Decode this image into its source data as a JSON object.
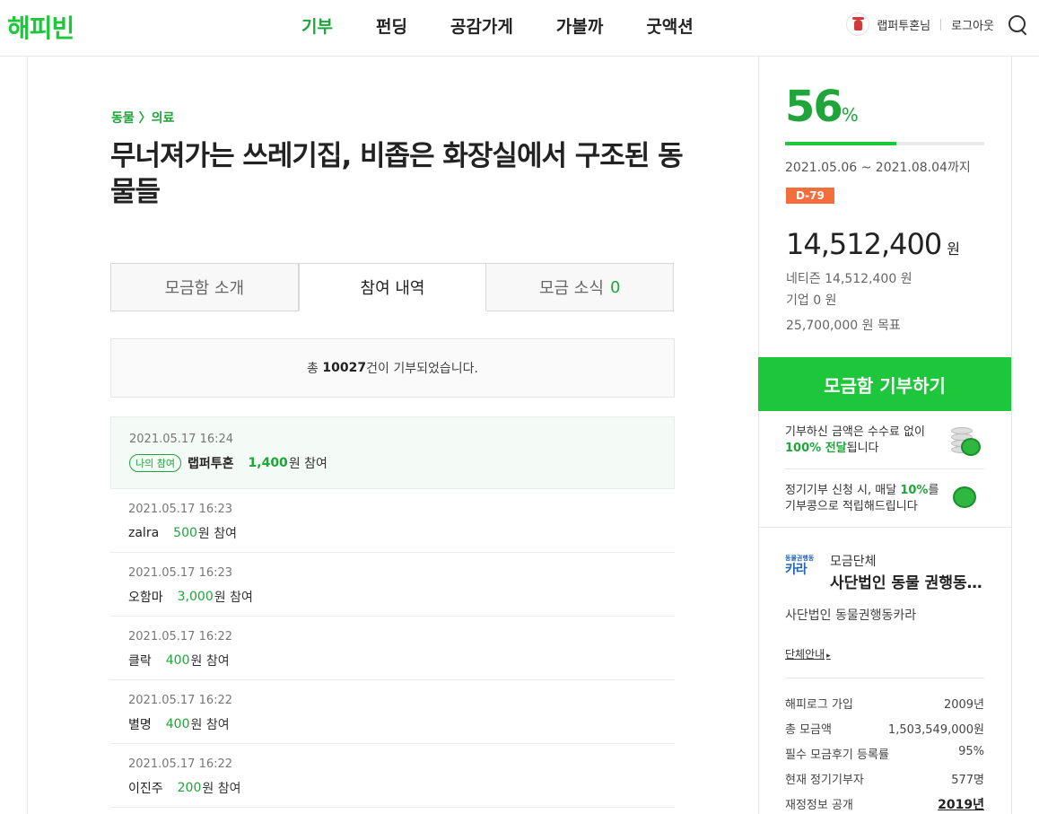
{
  "header": {
    "logo": "해피빈",
    "nav": [
      {
        "label": "기부",
        "active": true
      },
      {
        "label": "펀딩",
        "active": false
      },
      {
        "label": "공감가게",
        "active": false
      },
      {
        "label": "가볼까",
        "active": false
      },
      {
        "label": "굿액션",
        "active": false
      }
    ],
    "user_name": "랩퍼투혼님",
    "logout": "로그아웃",
    "search_icon": "search-icon"
  },
  "campaign": {
    "breadcrumb": "동물 〉의료",
    "title": "무너져가는 쓰레기집, 비좁은 화장실에서 구조된 동물들"
  },
  "tabs": [
    {
      "label": "모금함 소개",
      "active": false
    },
    {
      "label": "참여 내역",
      "active": true
    },
    {
      "label": "모금 소식",
      "count": "0",
      "active": false
    }
  ],
  "summary": {
    "prefix": "총 ",
    "count": "10027",
    "suffix": "건이 기부되었습니다."
  },
  "donations": [
    {
      "date": "2021.05.17 16:24",
      "badge": "나의 참여",
      "name": "랩퍼투혼",
      "amount": "1,400",
      "unit": "원 참여",
      "mine": true
    },
    {
      "date": "2021.05.17 16:23",
      "name": "zalra",
      "amount": "500",
      "unit": "원 참여"
    },
    {
      "date": "2021.05.17 16:23",
      "name": "오함마",
      "amount": "3,000",
      "unit": "원 참여"
    },
    {
      "date": "2021.05.17 16:22",
      "name": "클락",
      "amount": "400",
      "unit": "원 참여"
    },
    {
      "date": "2021.05.17 16:22",
      "name": "별명",
      "amount": "400",
      "unit": "원 참여"
    },
    {
      "date": "2021.05.17 16:22",
      "name": "이진주",
      "amount": "200",
      "unit": "원 참여"
    }
  ],
  "side": {
    "percent": "56",
    "percent_unit": "%",
    "progress_fraction": 0.56,
    "period": "2021.05.06 ~ 2021.08.04",
    "period_suffix": "까지",
    "dday": "D-79",
    "total": "14,512,400",
    "total_unit": "원",
    "netizen": "네티즌 14,512,400 원",
    "company": "기업 0 원",
    "goal": "25,700,000 원 목표",
    "donate_button": "모금함 기부하기",
    "info1_line1": "기부하신 금액은 수수료 없이",
    "info1_bold": "100% 전달",
    "info1_rest": "됩니다",
    "info2_pre": "정기기부 신청 시, 매달 ",
    "info2_bold": "10%",
    "info2_post": "를",
    "info2_line2": "기부콩으로 적립해드립니다"
  },
  "org": {
    "logo_small": "동물권행동",
    "logo_big": "카라",
    "label": "모금단체",
    "name": "사단법인 동물 권행동카라",
    "full_name": "사단법인 동물권행동카라",
    "link": "단체안내",
    "stats": [
      {
        "label": "해피로그 가입",
        "value": "2009년"
      },
      {
        "label": "총 모금액",
        "value": "1,503,549,000원"
      },
      {
        "label": "필수 모금후기 등록률",
        "value": "95%"
      },
      {
        "label": "현재 정기기부자",
        "value": "577명"
      },
      {
        "label": "재정정보 공개",
        "value": "2019년",
        "link": true
      }
    ]
  }
}
